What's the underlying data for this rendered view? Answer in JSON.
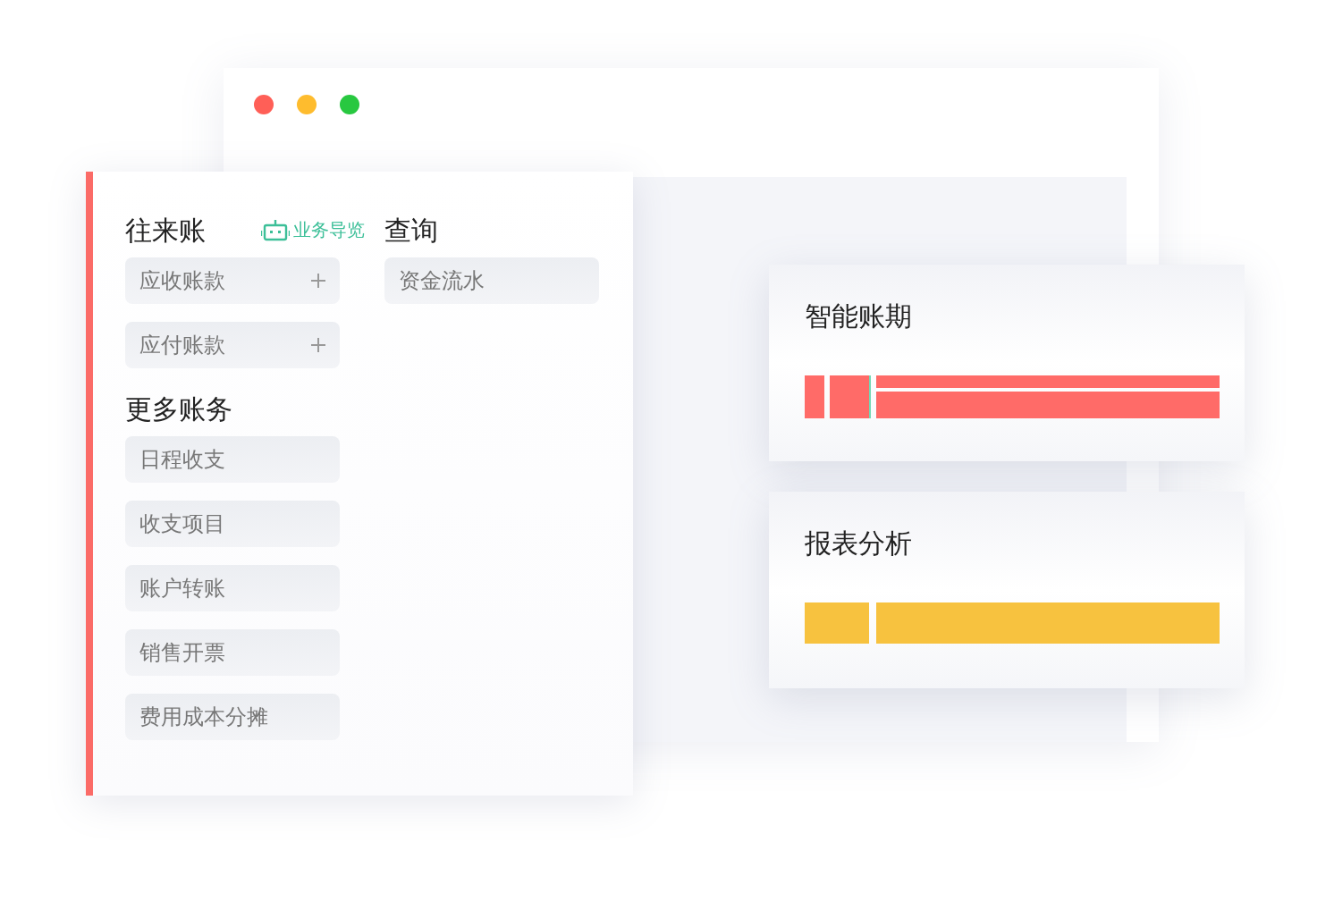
{
  "menu": {
    "columns": [
      {
        "sections": [
          {
            "heading": "往来账",
            "badge": "业务导览",
            "items": [
              {
                "label": "应收账款",
                "expandable": true
              },
              {
                "label": "应付账款",
                "expandable": true
              }
            ]
          },
          {
            "heading": "更多账务",
            "items": [
              {
                "label": "日程收支",
                "expandable": false
              },
              {
                "label": "收支项目",
                "expandable": false
              },
              {
                "label": "账户转账",
                "expandable": false
              },
              {
                "label": "销售开票",
                "expandable": false
              },
              {
                "label": "费用成本分摊",
                "expandable": false
              }
            ]
          }
        ]
      },
      {
        "sections": [
          {
            "heading": "查询",
            "items": [
              {
                "label": "资金流水",
                "expandable": false
              }
            ]
          }
        ]
      }
    ]
  },
  "cards": [
    {
      "title": "智能账期",
      "color": "#ff6b68",
      "kind": "split"
    },
    {
      "title": "报表分析",
      "color": "#f7c23f",
      "kind": "solid"
    }
  ]
}
